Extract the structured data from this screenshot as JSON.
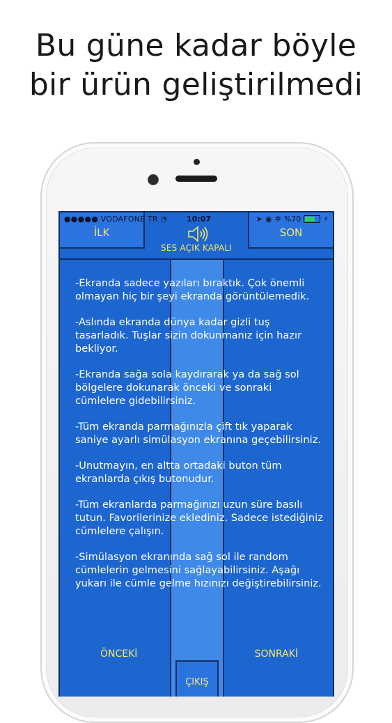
{
  "headline": {
    "line1": "Bu güne kadar böyle",
    "line2": "bir ürün geliştirilmedi"
  },
  "status_bar": {
    "carrier": "●●●●● VODAFONE TR",
    "time": "10:07",
    "battery": "%70"
  },
  "app": {
    "first_label": "İLK",
    "last_label": "SON",
    "sound_label": "SES AÇIK KAPALI",
    "prev_label": "ÖNCEKİ",
    "next_label": "SONRAKİ",
    "exit_label": "ÇIKIŞ",
    "paragraphs": [
      "-Ekranda sadece yazıları bıraktık. Çok önemli olmayan hiç bir şeyi ekranda görüntülemedik.",
      "-Aslında ekranda dünya kadar gizli tuş tasarladık. Tuşlar sizin dokunmanız için hazır bekliyor.",
      "-Ekranda sağa sola kaydırarak ya da sağ sol bölgelere dokunarak önceki ve sonraki cümlelere gidebilirsiniz.",
      "-Tüm ekranda parmağınızla çift tık yaparak saniye ayarlı simülasyon ekranına geçebilirsiniz.",
      "-Unutmayın, en altta ortadaki buton tüm ekranlarda çıkış butonudur.",
      "-Tüm ekranlarda parmağınızı uzun süre basılı tutun. Favorilerinize eklediniz. Sadece istediğiniz cümlelere çalışın.",
      "-Simülasyon ekranında sağ sol ile random cümlelerin gelmesini sağlayabilirsiniz. Aşağı yukarı ile cümle gelme hızınızı değiştirebilirsiniz."
    ]
  },
  "colors": {
    "screen_blue": "#1e66cf",
    "accent_yellow": "#f5e96a",
    "border_navy": "#0f2f63"
  }
}
